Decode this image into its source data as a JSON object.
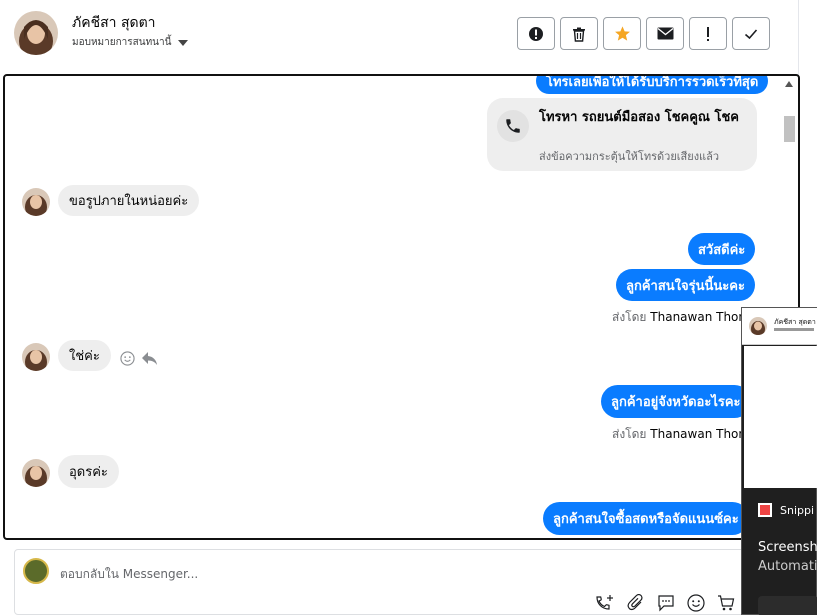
{
  "header": {
    "contact_name": "ภัคชีสา สุดตา",
    "assign_label": "มอบหมายการสนทนานี้",
    "actions": [
      {
        "name": "report-button",
        "icon": "alert-circle-icon"
      },
      {
        "name": "delete-button",
        "icon": "trash-icon"
      },
      {
        "name": "star-button",
        "icon": "star-icon"
      },
      {
        "name": "mark-unread-button",
        "icon": "mail-icon"
      },
      {
        "name": "important-button",
        "icon": "exclamation-icon"
      },
      {
        "name": "done-button",
        "icon": "check-icon"
      }
    ]
  },
  "chat": {
    "top_bubble": "โทรเลยเพื่อให้ได้รับบริการรวดเร็วที่สุด",
    "call_card": {
      "title": "โทรหา รถยนต์มือสอง โชคคูณ โชค",
      "subtitle": "ส่งข้อความกระตุ้นให้โทรด้วยเสียงแล้ว"
    },
    "messages": {
      "in_1": "ขอรูปภายในหน่อยค่ะ",
      "out_1": "สวัสดีค่ะ",
      "out_2": "ลูกค้าสนใจรุ่นนี้นะคะ",
      "sent_by_1_prefix": "ส่งโดย",
      "sent_by_1_name": "Thanawan Thon",
      "in_2": "ใช่ค่ะ",
      "out_3": "ลูกค้าอยู่จังหวัดอะไรคะ",
      "sent_by_2_prefix": "ส่งโดย",
      "sent_by_2_name": "Thanawan Thon",
      "in_3": "อุดรค่ะ",
      "out_4": "ลูกค้าสนใจซื้อสดหรือจัดแนนซ์คะ"
    }
  },
  "composer": {
    "placeholder": "ตอบกลับใน Messenger..."
  },
  "popup": {
    "name": "ภัคชีสา สุดตา",
    "snip_label": "Snippi",
    "line1": "Screensho",
    "line2": "Automatic"
  },
  "colors": {
    "accent_blue": "#0a7cff",
    "star_orange": "#f5a623",
    "incoming_gray": "#eeeeee"
  }
}
